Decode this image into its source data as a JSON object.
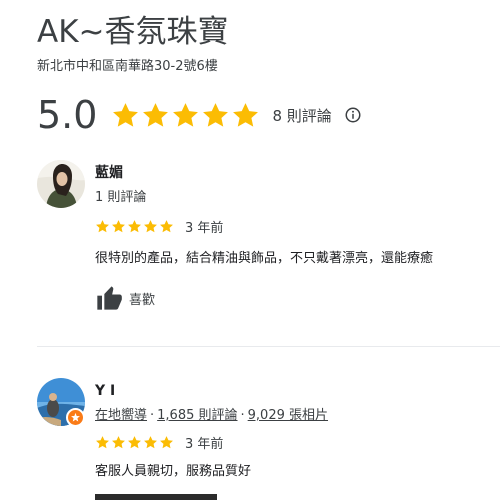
{
  "place": {
    "title": "AK~香氛珠寶",
    "address": "新北市中和區南華路30-2號6樓",
    "rating": "5.0",
    "review_count": "8 則評論"
  },
  "reviews": [
    {
      "name": "藍媚",
      "meta": "1 則評論",
      "stars": 5,
      "date": "3 年前",
      "text": "很特別的產品，結合精油與飾品，不只戴著漂亮，還能療癒",
      "like_label": "喜歡"
    },
    {
      "name": "Y I",
      "guide": "在地嚮導",
      "review_count": "1,685 則評論",
      "photo_count": "9,029 張相片",
      "stars": 5,
      "date": "3 年前",
      "text": "客服人員親切，服務品質好"
    }
  ],
  "icons": {
    "star": "star-icon",
    "info": "info-icon",
    "thumb": "thumbs-up-icon",
    "guide_badge": "local-guide-badge-icon"
  },
  "colors": {
    "star": "#fbbc04",
    "guide_badge": "#fa7b17",
    "text": "#202124",
    "muted": "#3c4043"
  }
}
